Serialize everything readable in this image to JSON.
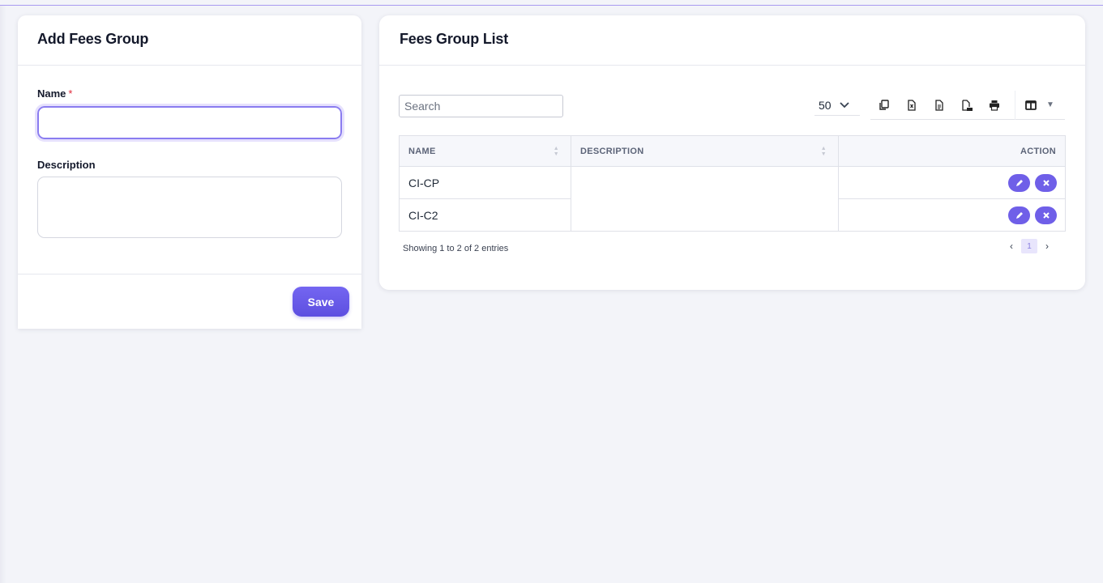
{
  "add_form": {
    "title": "Add Fees Group",
    "name_label": "Name",
    "required_mark": "*",
    "name_value": "",
    "description_label": "Description",
    "description_value": "",
    "save_label": "Save"
  },
  "list": {
    "title": "Fees Group List",
    "search_placeholder": "Search",
    "page_length": "50",
    "toolbar_icons": [
      "copy-icon",
      "excel-icon",
      "csv-icon",
      "pdf-icon",
      "print-icon",
      "columns-icon"
    ],
    "columns": [
      "NAME",
      "DESCRIPTION",
      "ACTION"
    ],
    "rows": [
      {
        "name": "CI-CP",
        "description": ""
      },
      {
        "name": "CI-C2",
        "description": ""
      }
    ],
    "info": "Showing 1 to 2 of 2 entries",
    "pager": {
      "prev": "‹",
      "current": "1",
      "next": "›"
    }
  },
  "colors": {
    "accent": "#6f5fe8",
    "background": "#f3f4f9"
  }
}
